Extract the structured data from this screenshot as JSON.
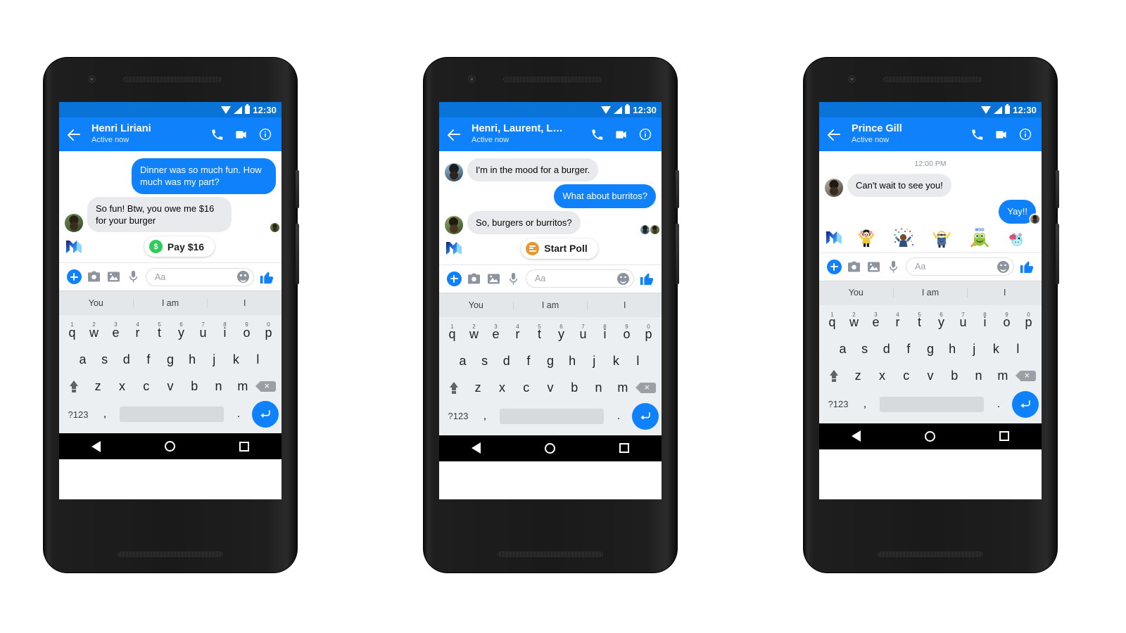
{
  "status_bar": {
    "time": "12:30",
    "wifi_icon": "wifi-icon",
    "signal_icon": "signal-icon",
    "battery_icon": "battery-icon"
  },
  "nav_bar": {
    "back": "back-triangle-icon",
    "home": "home-circle-icon",
    "recents": "recents-square-icon"
  },
  "composer": {
    "placeholder": "Aa",
    "plus_label": "plus-icon",
    "camera_label": "camera-icon",
    "gallery_label": "gallery-icon",
    "mic_label": "microphone-icon",
    "emoji_label": "emoji-icon",
    "like_label": "thumbs-up-icon"
  },
  "predictive": [
    "You",
    "I am",
    "I"
  ],
  "keyboard": {
    "row1": [
      {
        "key": "q",
        "num": "1"
      },
      {
        "key": "w",
        "num": "2"
      },
      {
        "key": "e",
        "num": "3"
      },
      {
        "key": "r",
        "num": "4"
      },
      {
        "key": "t",
        "num": "5"
      },
      {
        "key": "y",
        "num": "6"
      },
      {
        "key": "u",
        "num": "7"
      },
      {
        "key": "i",
        "num": "8"
      },
      {
        "key": "o",
        "num": "9"
      },
      {
        "key": "p",
        "num": "0"
      }
    ],
    "row2": [
      "a",
      "s",
      "d",
      "f",
      "g",
      "h",
      "j",
      "k",
      "l"
    ],
    "row3": [
      "z",
      "x",
      "c",
      "v",
      "b",
      "n",
      "m"
    ],
    "shift": "shift-icon",
    "delete": "backspace-icon",
    "symbols": "?123",
    "comma": ",",
    "period": ".",
    "space": "",
    "enter": "enter-icon"
  },
  "phones": [
    {
      "id": "phone-payments",
      "header": {
        "title": "Henri Liriani",
        "subtitle": "Active now"
      },
      "daystamp": null,
      "messages": [
        {
          "side": "out",
          "text": "Dinner was so much fun. How much was my part?",
          "avatar": null
        },
        {
          "side": "in",
          "text": "So fun! Btw, you owe me $16 for your burger",
          "avatar": "av-a"
        }
      ],
      "seen_avatars": [
        "av-a"
      ],
      "m_suggestion": {
        "logo": "messenger-m-icon",
        "pill_label": "Pay $16",
        "pill_icon": "money-icon",
        "pill_icon_glyph": "$"
      },
      "stickers": null
    },
    {
      "id": "phone-polls",
      "header": {
        "title": "Henri, Laurent, L…",
        "subtitle": "Active now"
      },
      "daystamp": null,
      "messages": [
        {
          "side": "in",
          "text": "I'm in the mood for a burger.",
          "avatar": "av-b"
        },
        {
          "side": "out",
          "text": "What about burritos?",
          "avatar": null
        },
        {
          "side": "in",
          "text": "So, burgers or burritos?",
          "avatar": "av-c"
        }
      ],
      "seen_avatars": [
        "av-b",
        "av-c"
      ],
      "m_suggestion": {
        "logo": "messenger-m-icon",
        "pill_label": "Start Poll",
        "pill_icon": "poll-icon",
        "pill_icon_glyph": ""
      },
      "stickers": null
    },
    {
      "id": "phone-stickers",
      "header": {
        "title": "Prince Gill",
        "subtitle": "Active now"
      },
      "daystamp": "12:00 PM",
      "messages": [
        {
          "side": "in",
          "text": "Can't wait to see you!",
          "avatar": "av-d"
        },
        {
          "side": "out",
          "text": "Yay!!",
          "avatar": null
        }
      ],
      "seen_avatars": [
        "av-d"
      ],
      "m_suggestion": null,
      "stickers": {
        "logo": "messenger-m-icon",
        "items": [
          {
            "name": "sticker-cheering-girl"
          },
          {
            "name": "sticker-confetti-celebration"
          },
          {
            "name": "sticker-minion-cheering"
          },
          {
            "name": "sticker-woo-hoo-frog"
          },
          {
            "name": "sticker-hippo-kiss"
          }
        ]
      }
    }
  ],
  "colors": {
    "messenger_blue": "#0f82fb",
    "status_blue": "#0a73d8",
    "incoming_bubble": "#e9eaed",
    "money_green": "#2ecc5a",
    "poll_orange": "#e8962f",
    "keyboard_bg": "#eceff1",
    "predict_bg": "#e4e7ea"
  }
}
